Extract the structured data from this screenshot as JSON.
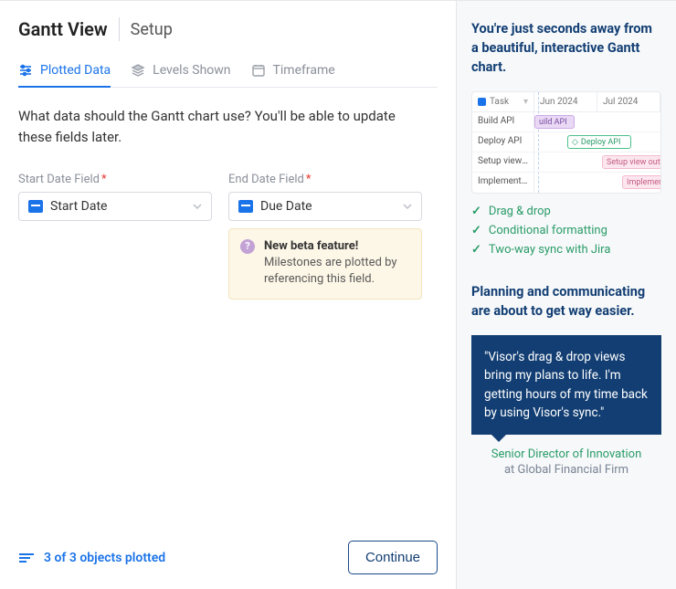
{
  "header": {
    "title": "Gantt View",
    "subtitle": "Setup"
  },
  "tabs": [
    {
      "id": "plotted",
      "label": "Plotted Data",
      "icon": "sliders",
      "active": true
    },
    {
      "id": "levels",
      "label": "Levels Shown",
      "icon": "layers",
      "active": false
    },
    {
      "id": "timeframe",
      "label": "Timeframe",
      "icon": "calendar",
      "active": false
    }
  ],
  "prompt": "What data should the Gantt chart use? You'll be able to update these fields later.",
  "fields": {
    "start": {
      "label": "Start Date Field",
      "value": "Start Date",
      "required": true
    },
    "end": {
      "label": "End Date Field",
      "value": "Due Date",
      "required": true
    }
  },
  "notice": {
    "bold": "New beta feature!",
    "text": "Milestones are plotted by referencing this field."
  },
  "footer": {
    "status": "3 of 3 objects plotted",
    "continue": "Continue"
  },
  "sidebar": {
    "heading1": "You're just seconds away from a beautiful, interactive Gantt chart.",
    "preview": {
      "task_header": "Task",
      "months": [
        "Jun 2024",
        "Jul 2024"
      ],
      "rows": [
        {
          "label": "Build API",
          "bar_label": "uild API"
        },
        {
          "label": "Deploy API",
          "bar_label": "Deploy API"
        },
        {
          "label": "Setup view o…",
          "bar_label": "Setup view outline"
        },
        {
          "label": "Implement I…",
          "bar_label": "Implement I"
        }
      ]
    },
    "checks": [
      "Drag & drop",
      "Conditional formatting",
      "Two-way sync with Jira"
    ],
    "heading2": "Planning and communicating are about to get way easier.",
    "quote": "\"Visor's drag & drop views bring my plans to life. I'm getting hours of my time back by using Visor's sync.\"",
    "attribution": {
      "role": "Senior Director of Innovation",
      "org": "at Global Financial Firm"
    }
  }
}
